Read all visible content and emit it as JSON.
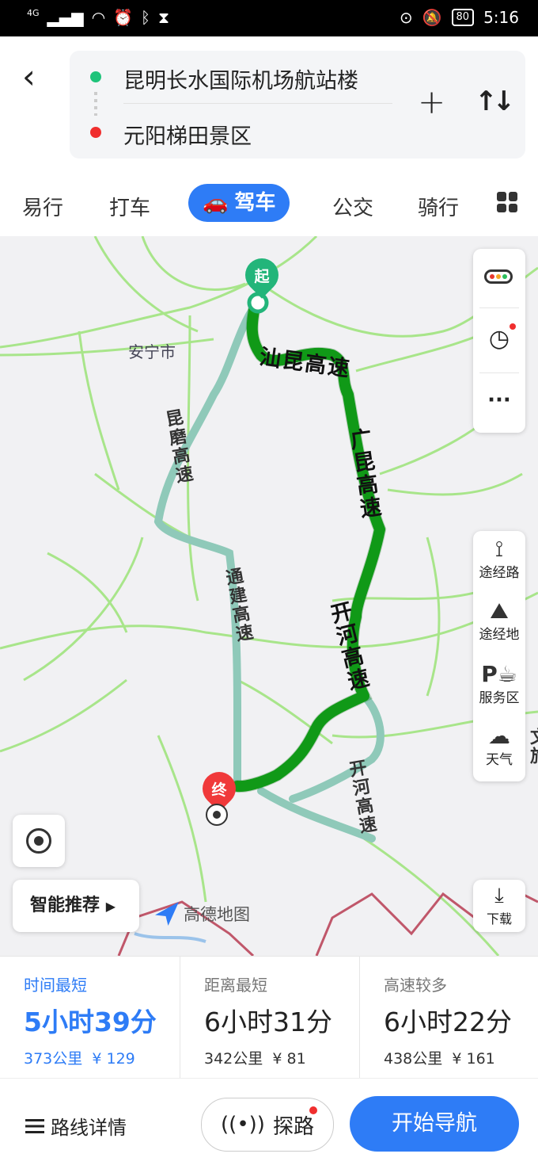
{
  "status_bar": {
    "network": "4G",
    "battery": "80",
    "time": "5:16"
  },
  "header": {
    "origin": "昆明长水国际机场航站楼",
    "destination": "元阳梯田景区"
  },
  "tabs": [
    {
      "label": "易行"
    },
    {
      "label": "打车"
    },
    {
      "label": "驾车",
      "active": true
    },
    {
      "label": "公交"
    },
    {
      "label": "骑行"
    }
  ],
  "map": {
    "city_label": "安宁市",
    "start_pin": "起",
    "end_pin": "终",
    "roads": {
      "r1": "汕昆高速",
      "r2": "广昆高速",
      "r3": "开河高速",
      "r4": "昆磨高速",
      "r5": "通建高速",
      "r6": "开河高速"
    },
    "edge_text": "文旅"
  },
  "side_tools": [
    {
      "label": "途经路",
      "icon": "route-icon"
    },
    {
      "label": "途经地",
      "icon": "map-pin-icon"
    },
    {
      "label": "服务区",
      "icon": "service-area-icon"
    },
    {
      "label": "天气",
      "icon": "cloud-icon"
    }
  ],
  "smart_recommend": "智能推荐",
  "logo_text": "高德地图",
  "download_label": "下载",
  "routes": [
    {
      "tag": "时间最短",
      "time": "5小时39分",
      "distance": "373公里",
      "toll": "¥ 129",
      "selected": true
    },
    {
      "tag": "距离最短",
      "time": "6小时31分",
      "distance": "342公里",
      "toll": "¥ 81"
    },
    {
      "tag": "高速较多",
      "time": "6小时22分",
      "distance": "438公里",
      "toll": "¥ 161"
    }
  ],
  "bottom": {
    "details": "路线详情",
    "explore": "探路",
    "start_navigation": "开始导航"
  },
  "colors": {
    "accent": "#2e7cf6",
    "route_main": "#12a81a",
    "route_alt": "#8fc9b9",
    "road_green": "#a8e58a"
  }
}
